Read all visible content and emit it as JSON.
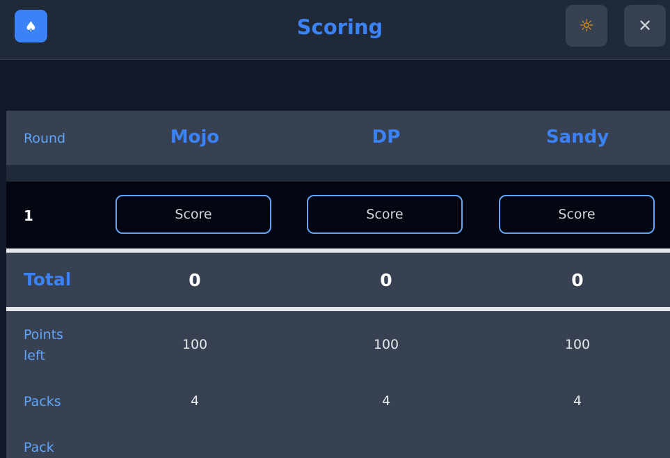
{
  "header": {
    "title": "Scoring",
    "app_icon": "spade-icon",
    "theme_icon": "sun-icon",
    "close_icon": "close-icon"
  },
  "table": {
    "round_header": "Round",
    "players": [
      "Mojo",
      "DP",
      "Sandy"
    ],
    "rounds": [
      {
        "number": "1",
        "score_placeholder": "Score"
      }
    ],
    "total_label": "Total",
    "totals": [
      "0",
      "0",
      "0"
    ],
    "points_left_label": "Points left",
    "points_left": [
      "100",
      "100",
      "100"
    ],
    "packs_label": "Packs",
    "packs": [
      "4",
      "4",
      "4"
    ],
    "pack_label": "Pack"
  },
  "colors": {
    "accent": "#3b82f6",
    "background": "#1f2937",
    "row_bg": "#374151",
    "input_bg": "#030712",
    "theme_icon": "#f59e0b"
  }
}
